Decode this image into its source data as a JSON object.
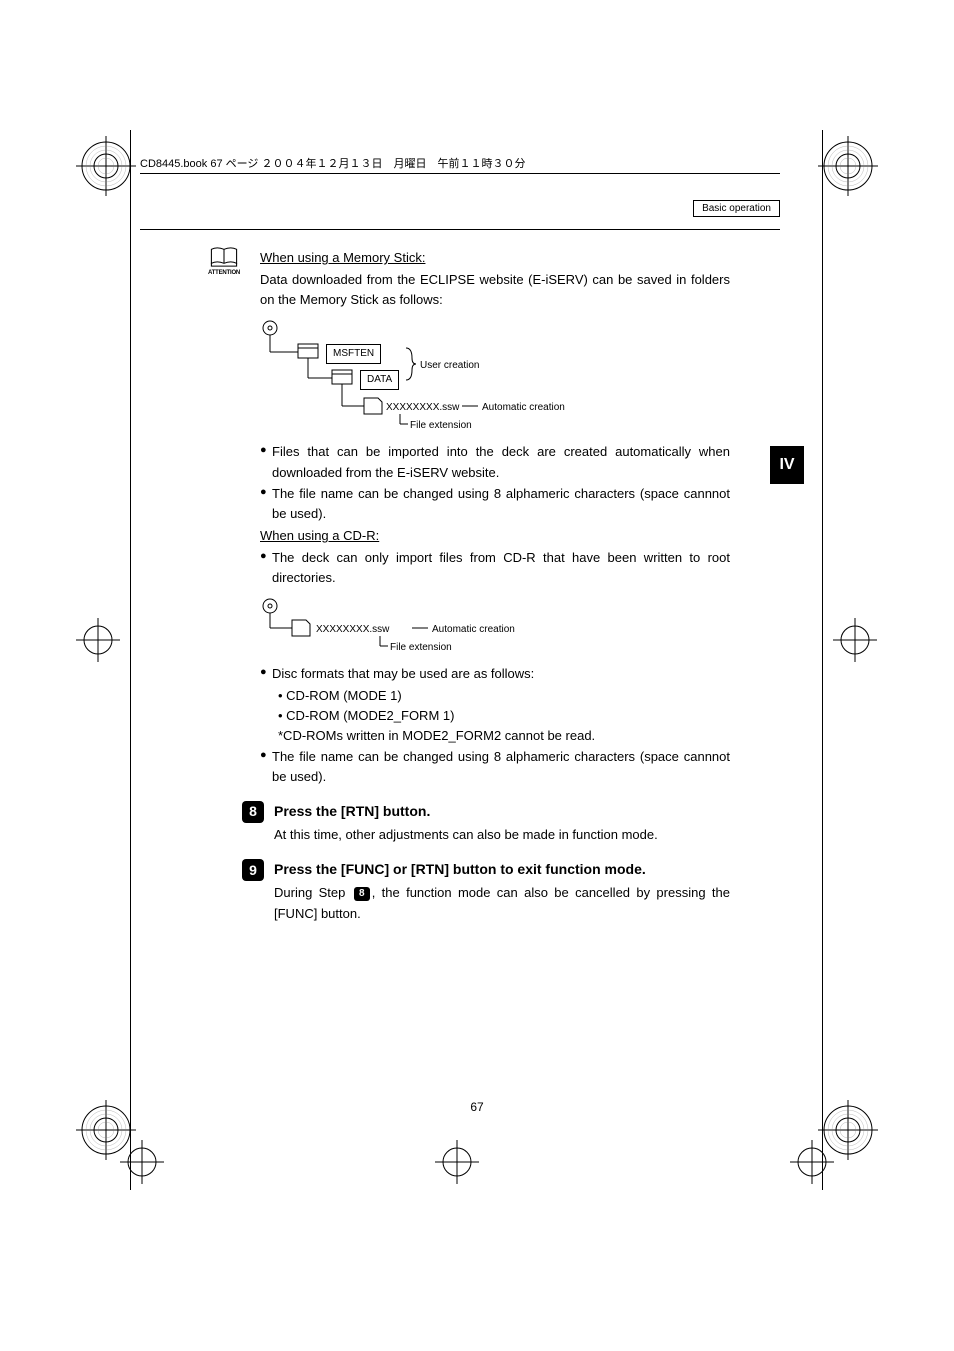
{
  "header": {
    "footer_line": "CD8445.book  67 ページ  ２００４年１２月１３日　月曜日　午前１１時３０分",
    "section_label": "Basic operation"
  },
  "side_tab": "IV",
  "attention_label": "ATTENTION",
  "section_ms": {
    "title": "When using a Memory Stick:",
    "intro": "Data downloaded from the ECLIPSE website (E-iSERV) can be saved in folders on the Memory Stick as follows:",
    "tree": {
      "folder1": "MSFTEN",
      "folder2": "DATA",
      "file": "XXXXXXXX.ssw",
      "note_user": "User creation",
      "note_auto": "Automatic creation",
      "note_ext": "File extension"
    },
    "bullets": [
      "Files that can be imported into the deck are created automatically when downloaded from the E-iSERV website.",
      "The file name can be changed using 8 alphameric characters (space cannnot be used)."
    ]
  },
  "section_cdr": {
    "title": "When using a CD-R:",
    "bullet1": "The deck can only import files from CD-R that have been written to root directories.",
    "tree": {
      "file": "XXXXXXXX.ssw",
      "note_auto": "Automatic creation",
      "note_ext": "File extension"
    },
    "disc_bullet": "Disc formats that may be used are as follows:",
    "disc_items": [
      "• CD-ROM (MODE 1)",
      "• CD-ROM (MODE2_FORM 1)",
      "*CD-ROMs written in MODE2_FORM2 cannot be read."
    ],
    "bullet_last": "The file name can be changed using 8 alphameric characters (space cannnot be used)."
  },
  "steps": {
    "s8": {
      "num": "8",
      "title": "Press the [RTN] button.",
      "body": "At this time, other adjustments can also be made in function mode."
    },
    "s9": {
      "num": "9",
      "title": "Press the [FUNC] or [RTN] button to exit function mode.",
      "body_prefix": "During Step ",
      "body_ref": "8",
      "body_suffix": ", the function mode can also be cancelled by pressing the [FUNC] button."
    }
  },
  "page_number": "67"
}
